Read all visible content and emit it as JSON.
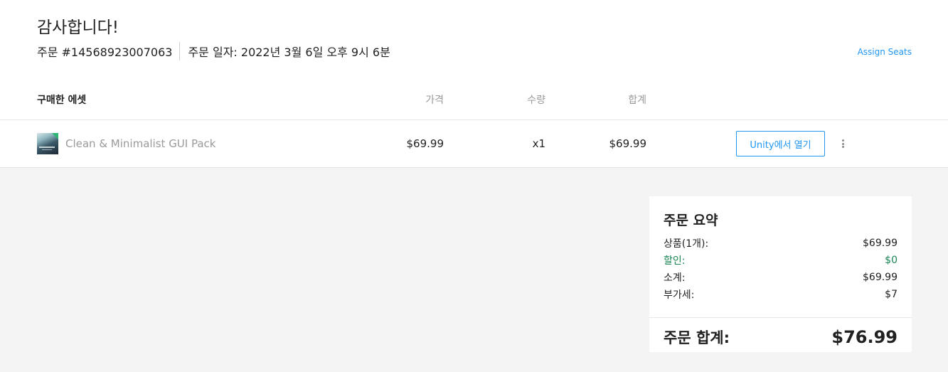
{
  "header": {
    "title": "감사합니다!",
    "order_number": "주문 #14568923007063",
    "order_date": "주문 일자: 2022년 3월 6일 오후 9시 6분",
    "assign_seats": "Assign Seats"
  },
  "table": {
    "headers": {
      "asset": "구매한 에셋",
      "price": "가격",
      "quantity": "수량",
      "total": "합계"
    },
    "rows": [
      {
        "thumbnail_icon": "asset-thumbnail",
        "name": "Clean & Minimalist GUI Pack",
        "price": "$69.99",
        "quantity": "x1",
        "total": "$69.99",
        "open_button": "Unity에서 열기",
        "menu_icon": "more-vertical-icon"
      }
    ]
  },
  "summary": {
    "title": "주문 요약",
    "items_label": "상품(1개):",
    "items_value": "$69.99",
    "discount_label": "할인:",
    "discount_value": "$0",
    "subtotal_label": "소계:",
    "subtotal_value": "$69.99",
    "tax_label": "부가세:",
    "tax_value": "$7",
    "total_label": "주문 합계:",
    "total_value": "$76.99"
  },
  "colors": {
    "accent": "#2196f3",
    "discount": "#1a8754",
    "background_gray": "#f4f4f4"
  }
}
